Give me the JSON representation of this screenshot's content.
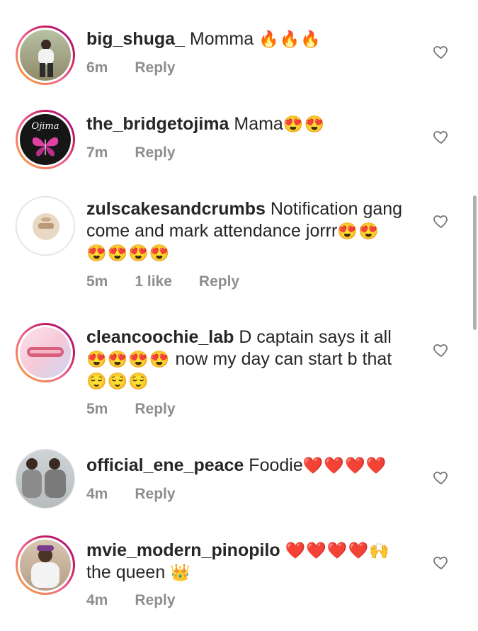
{
  "comments": [
    {
      "username": "big_shuga_",
      "text": "Momma",
      "emoji": "🔥🔥🔥",
      "extra": "",
      "time": "6m",
      "likes": "",
      "reply_label": "Reply"
    },
    {
      "username": "the_bridgetojima",
      "text": "Mama",
      "emoji": "😍😍",
      "extra": "",
      "time": "7m",
      "likes": "",
      "reply_label": "Reply",
      "avatar_label": "Ojima"
    },
    {
      "username": "zulscakesandcrumbs",
      "text": "Notification gang come and mark attendance jorrr",
      "emoji": "😍😍",
      "extra": "😍😍😍😍",
      "time": "5m",
      "likes": "1 like",
      "reply_label": "Reply"
    },
    {
      "username": "cleancoochie_lab",
      "text": "D captain says it all",
      "emoji": "😍😍😍😍",
      "extra": "now my day can start b that",
      "extra2": "😌😌😌",
      "time": "5m",
      "likes": "",
      "reply_label": "Reply"
    },
    {
      "username": "official_ene_peace",
      "text": "Foodie",
      "emoji": "❤️❤️❤️❤️",
      "extra": "",
      "time": "4m",
      "likes": "",
      "reply_label": "Reply"
    },
    {
      "username": "mvie_modern_pinopilo",
      "text": "",
      "emoji": "❤️❤️❤️❤️🙌",
      "extra": "the queen",
      "extra_emoji": "👑",
      "time": "4m",
      "likes": "",
      "reply_label": "Reply"
    }
  ],
  "colors": {
    "text": "#262626",
    "meta": "#8e8e8e",
    "ring_gradient": [
      "#f9a825",
      "#f06292",
      "#c2185b",
      "#9c27b0"
    ]
  },
  "icons": {
    "like": "heart-outline-icon"
  }
}
